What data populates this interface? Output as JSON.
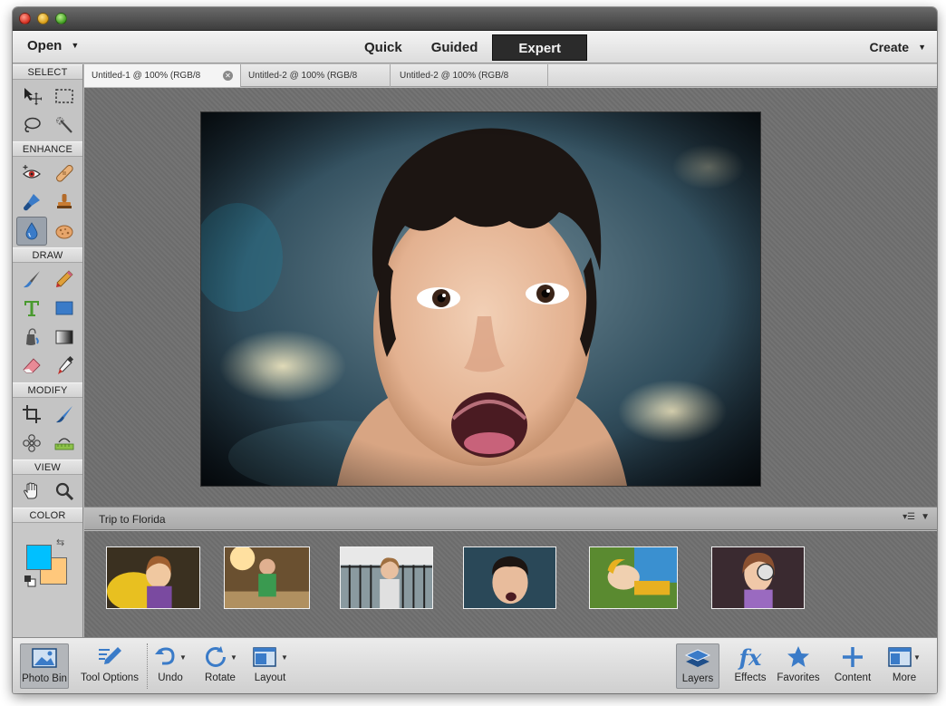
{
  "menus": {
    "open": "Open",
    "create": "Create"
  },
  "modes": [
    "Quick",
    "Guided",
    "Expert"
  ],
  "active_mode": "Expert",
  "toolbox": {
    "sections": {
      "select": "SELECT",
      "enhance": "ENHANCE",
      "draw": "DRAW",
      "modify": "MODIFY",
      "view": "VIEW",
      "color": "COLOR"
    },
    "foreground_color": "#00c0ff",
    "background_color": "#ffc87c",
    "selected_tool": "blur-tool"
  },
  "doc_tabs": [
    {
      "title": "Untitled-1 @ 100% (RGB/8",
      "active": true
    },
    {
      "title": "Untitled-2 @ 100% (RGB/8",
      "active": false
    },
    {
      "title": "Untitled-2 @ 100% (RGB/8",
      "active": false
    }
  ],
  "photo_bin": {
    "album": "Trip to Florida",
    "thumbnail_count": 6
  },
  "taskbar": {
    "photo_bin": "Photo Bin",
    "tool_options": "Tool Options",
    "undo": "Undo",
    "rotate": "Rotate",
    "layout": "Layout",
    "layers": "Layers",
    "effects": "Effects",
    "favorites": "Favorites",
    "content": "Content",
    "more": "More"
  },
  "colors": {
    "accent_blue": "#3a7bc8",
    "active_tab_dark": "#2b2b2b"
  }
}
